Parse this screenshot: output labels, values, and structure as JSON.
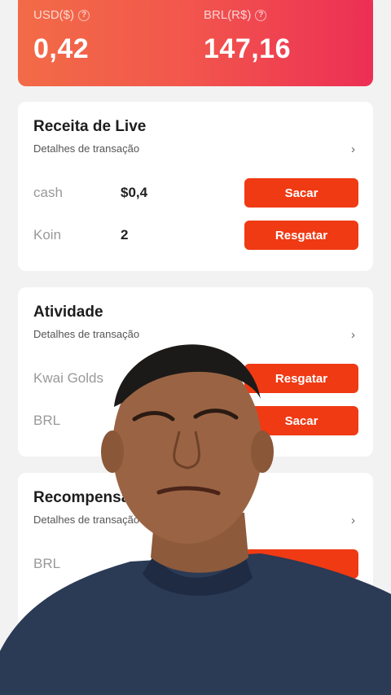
{
  "balance": {
    "usd_label": "USD($)",
    "usd_value": "0,42",
    "brl_label": "BRL(R$)",
    "brl_value": "147,16"
  },
  "live": {
    "title": "Receita de Live",
    "subtitle": "Detalhes de transação",
    "rows": [
      {
        "label": "cash",
        "value": "$0,4",
        "button": "Sacar"
      },
      {
        "label": "Koin",
        "value": "2",
        "button": "Resgatar"
      }
    ]
  },
  "atividade": {
    "title": "Atividade",
    "subtitle": "Detalhes de transação",
    "rows": [
      {
        "label": "Kwai Golds",
        "button": "Resgatar"
      },
      {
        "label": "BRL",
        "button": "Sacar"
      }
    ]
  },
  "recompensa": {
    "title": "Recompensa",
    "subtitle": "Detalhes de transação",
    "rows": [
      {
        "label": "BRL"
      }
    ]
  },
  "icons": {
    "help": "?",
    "chevron": "›"
  },
  "colors": {
    "accent_button": "#ef3a14",
    "balance_gradient_start": "#f26b47",
    "balance_gradient_end": "#ec2f55"
  }
}
